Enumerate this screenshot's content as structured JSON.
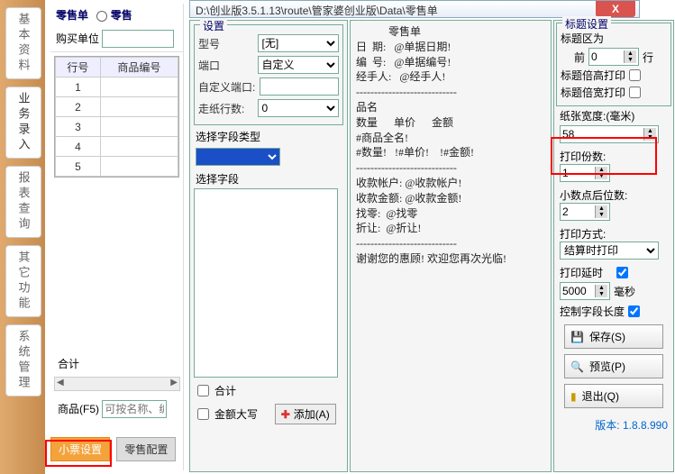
{
  "path": "D:\\创业版3.5.1.13\\route\\管家婆创业版\\Data\\零售单",
  "sidebar": {
    "tabs": [
      "基本资料",
      "业务录入",
      "报表查询",
      "其它功能",
      "系统管理"
    ],
    "active_index": 1
  },
  "left": {
    "title": "零售单",
    "retail_label": "零售",
    "buy_unit_label": "购买单位",
    "buy_unit_value": "",
    "columns": [
      "行号",
      "商品编号"
    ],
    "rows": [
      "1",
      "2",
      "3",
      "4",
      "5"
    ],
    "total_label": "合计",
    "goods_label": "商品(F5)",
    "goods_placeholder": "可按名称、编号",
    "btn_receipt": "小票设置",
    "btn_retail": "零售配置"
  },
  "mid": {
    "group_label": "设置",
    "model_label": "型号",
    "model_value": "[无]",
    "port_label": "端口",
    "port_value": "自定义",
    "custom_port_label": "自定义端口:",
    "custom_port_value": "",
    "paper_lines_label": "走纸行数:",
    "paper_lines_value": "0",
    "select_type_label": "选择字段类型",
    "select_type_value": "",
    "select_field_label": "选择字段",
    "chk_total": "合计",
    "chk_upper": "金额大写",
    "add_btn": "添加(A)"
  },
  "preview": {
    "lines": "            零售单\n日  期:   @单据日期!\n编  号:   @单据编号!\n经手人:   @经手人!\n----------------------------\n品名\n数量      单价      金额\n#商品全名!\n#数量!   !#单价!    !#金额!\n----------------------------\n收款帐户: @收款帐户!\n收款金额: @收款金额!\n找零:  @找零\n折让:  @折让!\n----------------------------\n谢谢您的惠顾! 欢迎您再次光临!"
  },
  "right": {
    "group_label": "标题设置",
    "title_area_label": "标题区为",
    "title_before": "前",
    "title_rows_val": "0",
    "title_after": "行",
    "double_high_label": "标题倍高打印",
    "double_high": false,
    "double_wide_label": "标题倍宽打印",
    "double_wide": false,
    "paper_width_label": "纸张宽度:(毫米)",
    "paper_width_value": "58",
    "copies_label": "打印份数:",
    "copies_value": "1",
    "decimals_label": "小数点后位数:",
    "decimals_value": "2",
    "print_mode_label": "打印方式:",
    "print_mode_value": "结算时打印",
    "delay_label": "打印延时",
    "delay_enabled": true,
    "delay_value": "5000",
    "delay_unit": "毫秒",
    "ctrl_len_label": "控制字段长度",
    "ctrl_len": true,
    "btn_save": "保存(S)",
    "btn_preview": "预览(P)",
    "btn_exit": "退出(Q)",
    "version": "版本: 1.8.8.990"
  }
}
